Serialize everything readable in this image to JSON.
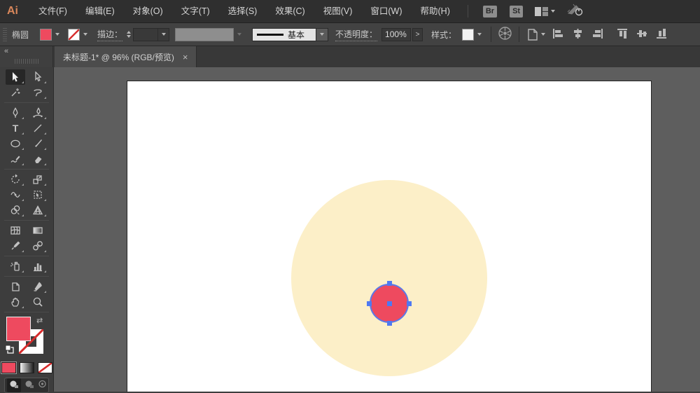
{
  "app": {
    "logo": "Ai"
  },
  "menubar": {
    "items": [
      "文件(F)",
      "编辑(E)",
      "对象(O)",
      "文字(T)",
      "选择(S)",
      "效果(C)",
      "视图(V)",
      "窗口(W)",
      "帮助(H)"
    ],
    "bridge_button": "Br",
    "stock_button": "St",
    "icons": [
      "workspace-switcher-icon",
      "gpu-performance-icon"
    ]
  },
  "controlbar": {
    "tool_label": "椭圆",
    "fill_color": "#ee4a5f",
    "stroke_label": "描边：",
    "stroke_weight_value": "",
    "brush_value": "基本",
    "opacity_label": "不透明度：",
    "opacity_value": "100%",
    "more_glyph": ">",
    "style_label": "样式：",
    "align_icons": [
      "horizontal-align-left",
      "horizontal-align-center",
      "horizontal-align-right",
      "vertical-align-top",
      "vertical-align-center",
      "vertical-align-bottom"
    ]
  },
  "tabbar": {
    "collapse_glyph": "«",
    "tab_title": "未标题-1* @ 96% (RGB/预览)",
    "close_glyph": "×"
  },
  "toolbar": {
    "type_glyph": "T",
    "tools": [
      "selection-tool",
      "direct-selection-tool",
      "magic-wand-tool",
      "lasso-tool",
      "pen-tool",
      "curvature-tool",
      "type-tool",
      "line-segment-tool",
      "ellipse-tool",
      "paintbrush-tool",
      "pencil-tool",
      "eraser-tool",
      "rotate-tool",
      "scale-tool",
      "width-tool",
      "free-transform-tool",
      "shape-builder-tool",
      "perspective-grid-tool",
      "mesh-tool",
      "gradient-tool",
      "eyedropper-tool",
      "blend-tool",
      "symbol-sprayer-tool",
      "column-graph-tool",
      "artboard-tool",
      "slice-tool",
      "hand-tool",
      "zoom-tool"
    ]
  },
  "fill_stroke": {
    "fill_color": "#ee4a5f",
    "swap_glyph": "⇄"
  },
  "canvas": {
    "pasteboard_color": "#5e5e5e",
    "artboard_color": "#ffffff",
    "outer_circle_color": "#fcefc8",
    "inner_circle_color": "#ee4a5f",
    "selection_color": "#4e79f2"
  }
}
